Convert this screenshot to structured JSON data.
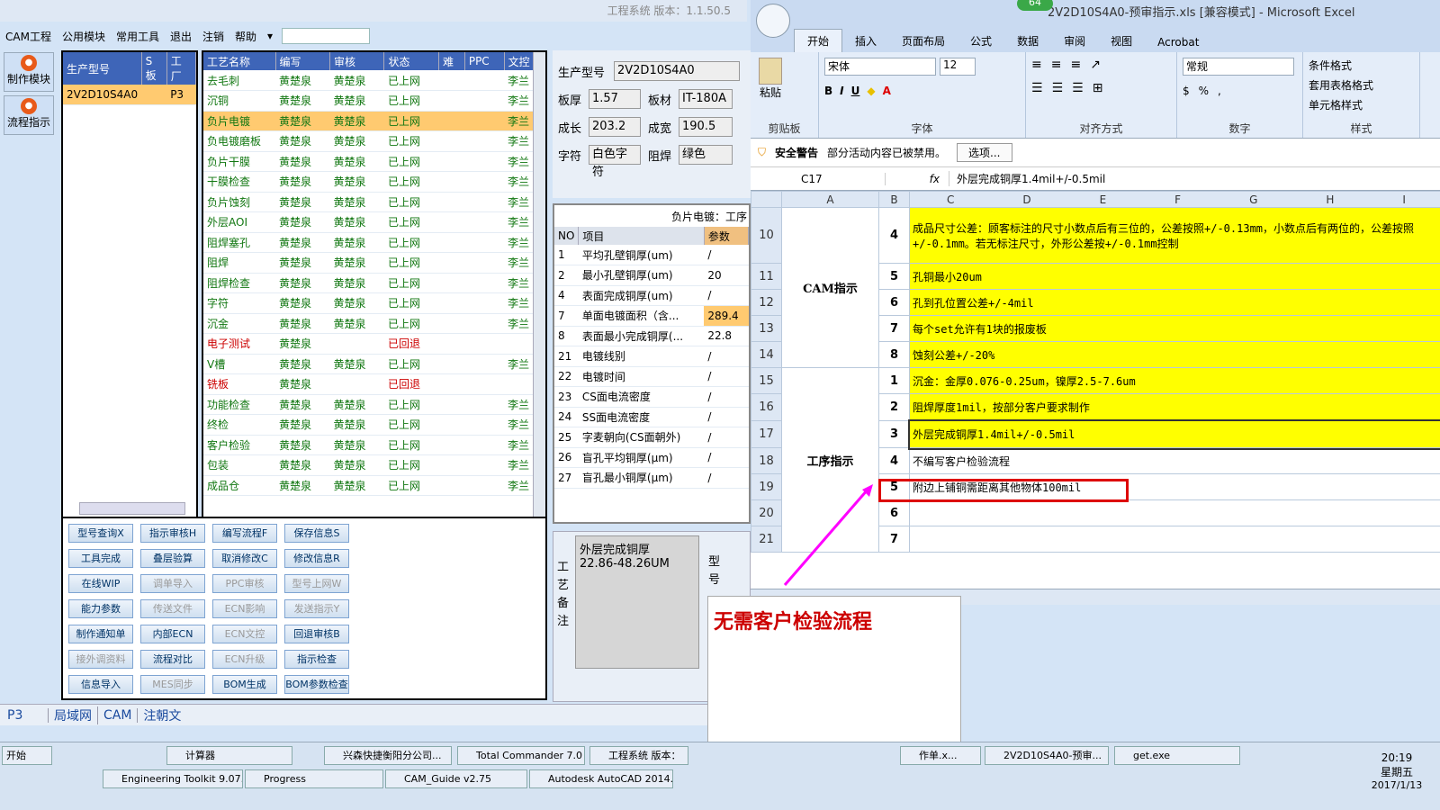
{
  "app": {
    "title": "工程系统   版本：1.1.50.5"
  },
  "menu": [
    "CAM工程",
    "公用模块",
    "常用工具",
    "退出",
    "注销",
    "帮助"
  ],
  "left_tools": [
    {
      "label": "制作模块"
    },
    {
      "label": "流程指示"
    }
  ],
  "model_table": {
    "headers": [
      "生产型号",
      "S板",
      "工厂"
    ],
    "rows": [
      [
        "2V2D10S4A0",
        "",
        "P3"
      ]
    ]
  },
  "process_table": {
    "headers": [
      "工艺名称",
      "编写",
      "审核",
      "状态",
      "难",
      "PPC",
      "文控"
    ],
    "rows": [
      [
        "去毛刺",
        "黄楚泉",
        "黄楚泉",
        "已上网",
        "",
        "",
        "李兰"
      ],
      [
        "沉铜",
        "黄楚泉",
        "黄楚泉",
        "已上网",
        "",
        "",
        "李兰"
      ],
      [
        "负片电镀",
        "黄楚泉",
        "黄楚泉",
        "已上网",
        "",
        "",
        "李兰"
      ],
      [
        "负电镀磨板",
        "黄楚泉",
        "黄楚泉",
        "已上网",
        "",
        "",
        "李兰"
      ],
      [
        "负片干膜",
        "黄楚泉",
        "黄楚泉",
        "已上网",
        "",
        "",
        "李兰"
      ],
      [
        "干膜检查",
        "黄楚泉",
        "黄楚泉",
        "已上网",
        "",
        "",
        "李兰"
      ],
      [
        "负片蚀刻",
        "黄楚泉",
        "黄楚泉",
        "已上网",
        "",
        "",
        "李兰"
      ],
      [
        "外层AOI",
        "黄楚泉",
        "黄楚泉",
        "已上网",
        "",
        "",
        "李兰"
      ],
      [
        "阻焊塞孔",
        "黄楚泉",
        "黄楚泉",
        "已上网",
        "",
        "",
        "李兰"
      ],
      [
        "阻焊",
        "黄楚泉",
        "黄楚泉",
        "已上网",
        "",
        "",
        "李兰"
      ],
      [
        "阻焊检查",
        "黄楚泉",
        "黄楚泉",
        "已上网",
        "",
        "",
        "李兰"
      ],
      [
        "字符",
        "黄楚泉",
        "黄楚泉",
        "已上网",
        "",
        "",
        "李兰"
      ],
      [
        "沉金",
        "黄楚泉",
        "黄楚泉",
        "已上网",
        "",
        "",
        "李兰"
      ],
      [
        "电子测试",
        "黄楚泉",
        "",
        "已回退",
        "",
        "",
        ""
      ],
      [
        "V槽",
        "黄楚泉",
        "黄楚泉",
        "已上网",
        "",
        "",
        "李兰"
      ],
      [
        "铣板",
        "黄楚泉",
        "",
        "已回退",
        "",
        "",
        ""
      ],
      [
        "功能检查",
        "黄楚泉",
        "黄楚泉",
        "已上网",
        "",
        "",
        "李兰"
      ],
      [
        "终检",
        "黄楚泉",
        "黄楚泉",
        "已上网",
        "",
        "",
        "李兰"
      ],
      [
        "客户检验",
        "黄楚泉",
        "黄楚泉",
        "已上网",
        "",
        "",
        "李兰"
      ],
      [
        "包装",
        "黄楚泉",
        "黄楚泉",
        "已上网",
        "",
        "",
        "李兰"
      ],
      [
        "成品仓",
        "黄楚泉",
        "黄楚泉",
        "已上网",
        "",
        "",
        "李兰"
      ]
    ]
  },
  "buttons": [
    [
      "型号查询X",
      "指示审核H",
      "编写流程F",
      "保存信息S"
    ],
    [
      "工具完成",
      "叠层验算",
      "取消修改C",
      "修改信息R"
    ],
    [
      "在线WIP",
      "调单导入",
      "PPC审核",
      "型号上网W"
    ],
    [
      "能力参数",
      "传送文件",
      "ECN影响",
      "发送指示Y"
    ],
    [
      "制作通知单",
      "内部ECN",
      "ECN文控",
      "回退审核B"
    ],
    [
      "接外调资料",
      "流程对比",
      "ECN升级",
      "指示检查"
    ],
    [
      "信息导入",
      "MES同步",
      "BOM生成",
      "BOM参数检查"
    ]
  ],
  "info": {
    "model_label": "生产型号",
    "model": "2V2D10S4A0",
    "thick_label": "板厚",
    "thick": "1.57",
    "mat_label": "板材",
    "mat": "IT-180A",
    "len_label": "成长",
    "len": "203.2",
    "wid_label": "成宽",
    "wid": "190.5",
    "char_label": "字符",
    "char": "白色字符",
    "mask_label": "阻焊",
    "mask": "绿色"
  },
  "param_table": {
    "caption": "负片电镀：工序",
    "headers": [
      "NO",
      "项目",
      "参数"
    ],
    "rows": [
      [
        "1",
        "平均孔壁铜厚(um)",
        "/"
      ],
      [
        "2",
        "最小孔壁铜厚(um)",
        "20"
      ],
      [
        "4",
        "表面完成铜厚(um)",
        "/"
      ],
      [
        "7",
        "单面电镀面积（含...",
        "289.4"
      ],
      [
        "8",
        "表面最小完成铜厚(...",
        "22.8"
      ],
      [
        "21",
        "电镀线别",
        "/"
      ],
      [
        "22",
        "电镀时间",
        "/"
      ],
      [
        "23",
        "CS面电流密度",
        "/"
      ],
      [
        "24",
        "SS面电流密度",
        "/"
      ],
      [
        "25",
        "字麦朝向(CS面朝外)",
        "/"
      ],
      [
        "26",
        "盲孔平均铜厚(μm)",
        "/"
      ],
      [
        "27",
        "盲孔最小铜厚(μm)",
        "/"
      ]
    ]
  },
  "remark": {
    "side": "工艺备注",
    "text1": "外层完成铜厚",
    "text2": "22.86-48.26UM",
    "side2": "型号"
  },
  "status": {
    "combo": "P3",
    "tabs": [
      "局域网",
      "CAM",
      "注朝文"
    ]
  },
  "excel": {
    "title": "2V2D10S4A0-预审指示.xls  [兼容模式] - Microsoft Excel",
    "badge": "64",
    "tabs": [
      "开始",
      "插入",
      "页面布局",
      "公式",
      "数据",
      "审阅",
      "视图",
      "Acrobat"
    ],
    "font": "宋体",
    "size": "12",
    "numfmt": "常规",
    "groups": [
      "剪贴板",
      "字体",
      "对齐方式",
      "数字",
      "样式"
    ],
    "paste": "粘贴",
    "styles": [
      "条件格式",
      "套用表格格式",
      "单元格样式"
    ],
    "security_label": "安全警告",
    "security_text": "部分活动内容已被禁用。",
    "options": "选项...",
    "cellref": "C17",
    "fx": "fx",
    "formula": "外层完成铜厚1.4mil+/-0.5mil",
    "cols": [
      "A",
      "B",
      "C",
      "D",
      "E",
      "F",
      "G",
      "H",
      "I"
    ],
    "cam_label": "CAM指示",
    "proc_label": "工序指示",
    "rows": [
      {
        "rn": "10",
        "b": "4",
        "c": "成品尺寸公差：顾客标注的尺寸小数点后有三位的，公差按照+/-0.13mm，小数点后有两位的，公差按照+/-0.1mm。若无标注尺寸，外形公差按+/-0.1mm控制",
        "y": true
      },
      {
        "rn": "11",
        "b": "5",
        "c": "孔铜最小20um",
        "y": true
      },
      {
        "rn": "12",
        "b": "6",
        "c": "孔到孔位置公差+/-4mil",
        "y": true
      },
      {
        "rn": "13",
        "b": "7",
        "c": "每个set允许有1块的报废板",
        "y": true
      },
      {
        "rn": "14",
        "b": "8",
        "c": "蚀刻公差+/-20%",
        "y": true
      },
      {
        "rn": "15",
        "b": "1",
        "c": "沉金：金厚0.076-0.25um，镍厚2.5-7.6um",
        "y": true
      },
      {
        "rn": "16",
        "b": "2",
        "c": "阻焊厚度1mil，按部分客户要求制作",
        "y": true
      },
      {
        "rn": "17",
        "b": "3",
        "c": "外层完成铜厚1.4mil+/-0.5mil",
        "y": true
      },
      {
        "rn": "18",
        "b": "4",
        "c": "不编写客户检验流程",
        "y": false
      },
      {
        "rn": "19",
        "b": "5",
        "c": "附边上铺铜需距离其他物体100mil",
        "y": false
      },
      {
        "rn": "20",
        "b": "6",
        "c": "",
        "y": false
      },
      {
        "rn": "21",
        "b": "7",
        "c": "",
        "y": false
      }
    ]
  },
  "annotation": "无需客户检验流程",
  "taskbar": {
    "start": "开始",
    "row1": [
      "计算器",
      "兴森快捷衡阳分公司...",
      "Total Commander 7.0 ...",
      "工程系统 版本：",
      "作单.x...",
      "2V2D10S4A0-预审...",
      "get.exe"
    ],
    "row2": [
      "Engineering Toolkit 9.07...",
      "Progress",
      "CAM_Guide v2.75",
      "Autodesk AutoCAD 2014..."
    ],
    "time": "20:19",
    "day": "星期五",
    "date": "2017/1/13"
  },
  "colors": {
    "header_blue": "#3e65b8",
    "ok_green": "#117711",
    "back_red": "#cc0000",
    "annot_magenta": "#ff00ff",
    "highlight_red": "#dd0000",
    "yellow": "#ffff00"
  }
}
